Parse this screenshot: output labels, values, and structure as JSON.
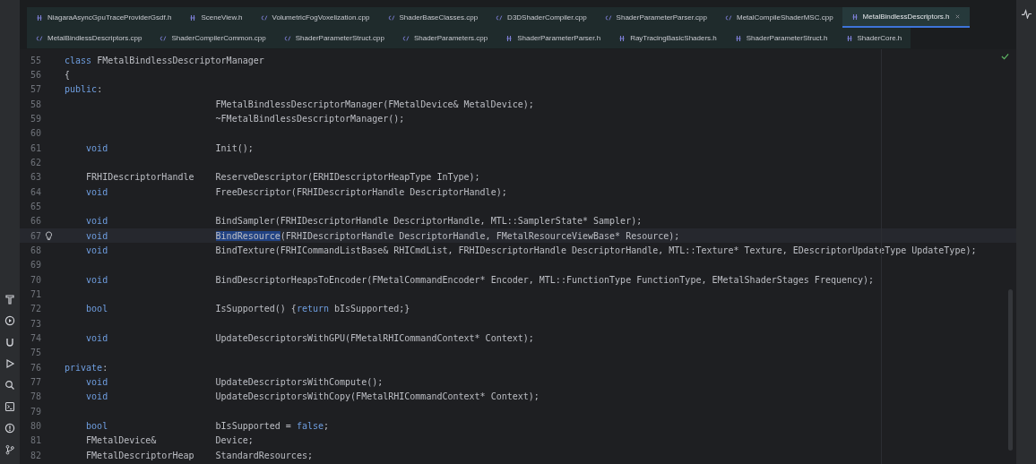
{
  "tab_rows": [
    [
      {
        "label": "NiagaraAsyncGpuTraceProviderGsdf.h",
        "kind": "header",
        "selected": false
      },
      {
        "label": "SceneView.h",
        "kind": "header",
        "selected": false
      },
      {
        "label": "VolumetricFogVoxelization.cpp",
        "kind": "source",
        "selected": false
      },
      {
        "label": "ShaderBaseClasses.cpp",
        "kind": "source",
        "selected": false
      },
      {
        "label": "D3DShaderCompiler.cpp",
        "kind": "source",
        "selected": false
      },
      {
        "label": "ShaderParameterParser.cpp",
        "kind": "source",
        "selected": false
      },
      {
        "label": "MetalCompileShaderMSC.cpp",
        "kind": "source",
        "selected": false
      },
      {
        "label": "MetalBindlessDescriptors.h",
        "kind": "header",
        "selected": true
      }
    ],
    [
      {
        "label": "MetalBindlessDescriptors.cpp",
        "kind": "source",
        "selected": false
      },
      {
        "label": "ShaderCompilerCommon.cpp",
        "kind": "source",
        "selected": false
      },
      {
        "label": "ShaderParameterStruct.cpp",
        "kind": "source",
        "selected": false
      },
      {
        "label": "ShaderParameters.cpp",
        "kind": "source",
        "selected": false
      },
      {
        "label": "ShaderParameterParser.h",
        "kind": "header",
        "selected": false
      },
      {
        "label": "RayTracingBasicShaders.h",
        "kind": "header",
        "selected": false
      },
      {
        "label": "ShaderParameterStruct.h",
        "kind": "header",
        "selected": false
      },
      {
        "label": "ShaderCore.h",
        "kind": "header",
        "selected": false
      }
    ]
  ],
  "lines": [
    {
      "number": "55",
      "current": false,
      "bulb": false,
      "tokens": [
        {
          "kind": "keyword",
          "text": "class"
        },
        {
          "kind": "plain",
          "text": " FMetalBindlessDescriptorManager"
        }
      ]
    },
    {
      "number": "56",
      "current": false,
      "bulb": false,
      "tokens": [
        {
          "kind": "plain",
          "text": "{"
        }
      ]
    },
    {
      "number": "57",
      "current": false,
      "bulb": false,
      "tokens": [
        {
          "kind": "keyword",
          "text": "public"
        },
        {
          "kind": "plain",
          "text": ":"
        }
      ]
    },
    {
      "number": "58",
      "current": false,
      "bulb": false,
      "tokens": [
        {
          "kind": "plain",
          "text": "                            FMetalBindlessDescriptorManager(FMetalDevice& MetalDevice);"
        }
      ]
    },
    {
      "number": "59",
      "current": false,
      "bulb": false,
      "tokens": [
        {
          "kind": "plain",
          "text": "                            ~FMetalBindlessDescriptorManager();"
        }
      ]
    },
    {
      "number": "60",
      "current": false,
      "bulb": false
    },
    {
      "number": "61",
      "current": false,
      "bulb": false,
      "tokens": [
        {
          "kind": "keyword",
          "text": "    void"
        },
        {
          "kind": "plain",
          "text": "                    Init();"
        }
      ]
    },
    {
      "number": "62",
      "current": false,
      "bulb": false
    },
    {
      "number": "63",
      "current": false,
      "bulb": false,
      "tokens": [
        {
          "kind": "plain",
          "text": "    FRHIDescriptorHandle    ReserveDescriptor(ERHIDescriptorHeapType InType);"
        }
      ]
    },
    {
      "number": "64",
      "current": false,
      "bulb": false,
      "tokens": [
        {
          "kind": "keyword",
          "text": "    void"
        },
        {
          "kind": "plain",
          "text": "                    FreeDescriptor(FRHIDescriptorHandle DescriptorHandle);"
        }
      ]
    },
    {
      "number": "65",
      "current": false,
      "bulb": false
    },
    {
      "number": "66",
      "current": false,
      "bulb": false,
      "tokens": [
        {
          "kind": "keyword",
          "text": "    void"
        },
        {
          "kind": "plain",
          "text": "                    BindSampler(FRHIDescriptorHandle DescriptorHandle, MTL::SamplerState* Sampler);"
        }
      ]
    },
    {
      "number": "67",
      "current": true,
      "bulb": true,
      "tokens": [
        {
          "kind": "keyword",
          "text": "    void                    "
        },
        {
          "kind": "selected",
          "text": "BindResource"
        },
        {
          "kind": "plain",
          "text": "(FRHIDescriptorHandle DescriptorHandle, FMetalResourceViewBase* Resource);"
        }
      ]
    },
    {
      "number": "68",
      "current": false,
      "bulb": false,
      "tokens": [
        {
          "kind": "keyword",
          "text": "    void"
        },
        {
          "kind": "plain",
          "text": "                    BindTexture(FRHICommandListBase& RHICmdList, FRHIDescriptorHandle DescriptorHandle, MTL::Texture* Texture, EDescriptorUpdateType UpdateType);"
        }
      ]
    },
    {
      "number": "69",
      "current": false,
      "bulb": false
    },
    {
      "number": "70",
      "current": false,
      "bulb": false,
      "tokens": [
        {
          "kind": "keyword",
          "text": "    void"
        },
        {
          "kind": "plain",
          "text": "                    BindDescriptorHeapsToEncoder(FMetalCommandEncoder* Encoder, MTL::FunctionType FunctionType, EMetalShaderStages Frequency);"
        }
      ]
    },
    {
      "number": "71",
      "current": false,
      "bulb": false
    },
    {
      "number": "72",
      "current": false,
      "bulb": false,
      "tokens": [
        {
          "kind": "keyword",
          "text": "    bool"
        },
        {
          "kind": "plain",
          "text": "                    IsSupported() {"
        },
        {
          "kind": "keyword",
          "text": "return"
        },
        {
          "kind": "plain",
          "text": " bIsSupported;}"
        }
      ]
    },
    {
      "number": "73",
      "current": false,
      "bulb": false
    },
    {
      "number": "74",
      "current": false,
      "bulb": false,
      "tokens": [
        {
          "kind": "keyword",
          "text": "    void"
        },
        {
          "kind": "plain",
          "text": "                    UpdateDescriptorsWithGPU(FMetalRHICommandContext* Context);"
        }
      ]
    },
    {
      "number": "75",
      "current": false,
      "bulb": false
    },
    {
      "number": "76",
      "current": false,
      "bulb": false,
      "tokens": [
        {
          "kind": "keyword",
          "text": "private"
        },
        {
          "kind": "plain",
          "text": ":"
        }
      ]
    },
    {
      "number": "77",
      "current": false,
      "bulb": false,
      "tokens": [
        {
          "kind": "keyword",
          "text": "    void"
        },
        {
          "kind": "plain",
          "text": "                    UpdateDescriptorsWithCompute();"
        }
      ]
    },
    {
      "number": "78",
      "current": false,
      "bulb": false,
      "tokens": [
        {
          "kind": "keyword",
          "text": "    void"
        },
        {
          "kind": "plain",
          "text": "                    UpdateDescriptorsWithCopy(FMetalRHICommandContext* Context);"
        }
      ]
    },
    {
      "number": "79",
      "current": false,
      "bulb": false
    },
    {
      "number": "80",
      "current": false,
      "bulb": false,
      "tokens": [
        {
          "kind": "keyword",
          "text": "    bool"
        },
        {
          "kind": "plain",
          "text": "                    bIsSupported = "
        },
        {
          "kind": "keyword",
          "text": "false"
        },
        {
          "kind": "plain",
          "text": ";"
        }
      ]
    },
    {
      "number": "81",
      "current": false,
      "bulb": false,
      "tokens": [
        {
          "kind": "plain",
          "text": "    FMetalDevice&           Device;"
        }
      ]
    },
    {
      "number": "82",
      "current": false,
      "bulb": false,
      "tokens": [
        {
          "kind": "plain",
          "text": "    FMetalDescriptorHeap    StandardResources;"
        }
      ]
    }
  ]
}
